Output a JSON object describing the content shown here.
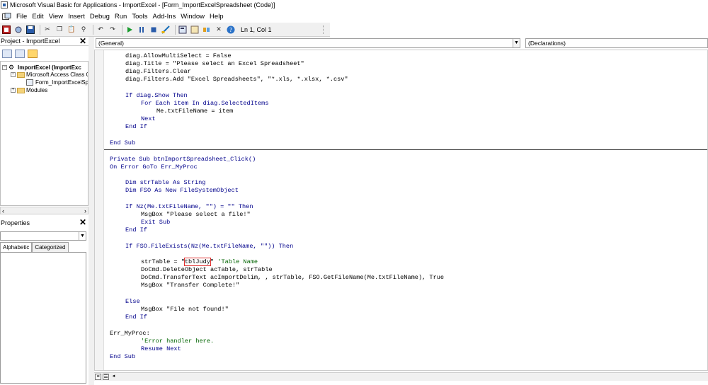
{
  "window": {
    "title": "Microsoft Visual Basic for Applications - ImportExcel - [Form_ImportExcelSpreadsheet (Code)]"
  },
  "menu": [
    "File",
    "Edit",
    "View",
    "Insert",
    "Debug",
    "Run",
    "Tools",
    "Add-Ins",
    "Window",
    "Help"
  ],
  "toolbar": {
    "position": "Ln 1, Col 1"
  },
  "project": {
    "title": "Project - ImportExcel",
    "root": "ImportExcel (ImportExc",
    "class_folder": "Microsoft Access Class C",
    "form": "Form_ImportExcelSp",
    "modules": "Modules"
  },
  "properties": {
    "title": "Properties",
    "tab_alpha": "Alphabetic",
    "tab_cat": "Categorized"
  },
  "editor": {
    "object": "(General)",
    "procedure": "(Declarations)"
  },
  "code": {
    "l1": "diag.AllowMultiSelect = False",
    "l2": "diag.Title = \"Please select an Excel Spreadsheet\"",
    "l3": "diag.Filters.Clear",
    "l4": "diag.Filters.Add \"Excel Spreadsheets\", \"*.xls, *.xlsx, *.csv\"",
    "l5": "If diag.Show Then",
    "l6": "For Each item In diag.SelectedItems",
    "l7": "Me.txtFileName = item",
    "l8": "Next",
    "l9": "End If",
    "l10": "End Sub",
    "l11": "Private Sub btnImportSpreadsheet_Click()",
    "l12": "On Error GoTo Err_MyProc",
    "l13": "Dim strTable As String",
    "l14": "Dim FSO As New FileSystemObject",
    "l15": "If Nz(Me.txtFileName, \"\") = \"\" Then",
    "l16": "MsgBox \"Please select a file!\"",
    "l17": "Exit Sub",
    "l18": "End If",
    "l19": "If FSO.FileExists(Nz(Me.txtFileName, \"\")) Then",
    "l20a": "strTable = \"",
    "l20b": "tblJudy",
    "l20c": "\" ",
    "l20d": "'Table Name",
    "l21": "DoCmd.DeleteObject acTable, strTable",
    "l22": "DoCmd.TransferText acImportDelim, , strTable, FSO.GetFileName(Me.txtFileName), True",
    "l23": "MsgBox \"Transfer Complete!\"",
    "l24": "Else",
    "l25": "MsgBox \"File not found!\"",
    "l26": "End If",
    "l27": "Err_MyProc:",
    "l28": "'Error handler here.",
    "l29": "Resume Next",
    "l30": "End Sub"
  }
}
